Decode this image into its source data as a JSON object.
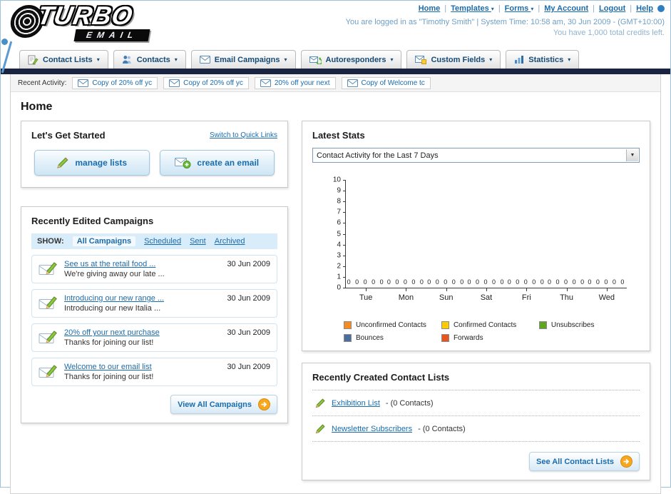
{
  "logo": {
    "line1": "TURBO",
    "line2": "EMAIL"
  },
  "header": {
    "links": [
      {
        "label": "Home",
        "dropdown": false
      },
      {
        "label": "Templates",
        "dropdown": true
      },
      {
        "label": "Forms",
        "dropdown": true
      },
      {
        "label": "My Account",
        "dropdown": false
      },
      {
        "label": "Logout",
        "dropdown": false
      },
      {
        "label": "Help",
        "dropdown": false
      }
    ],
    "login_line": "You are logged in as \"Timothy Smith\" | System Time: 10:58 am, 30 Jun 2009 - (GMT+10:00)",
    "credits_line": "You have 1,000 total credits left."
  },
  "main_nav": [
    {
      "label": "Contact Lists",
      "icon": "contact-lists"
    },
    {
      "label": "Contacts",
      "icon": "contacts"
    },
    {
      "label": "Email Campaigns",
      "icon": "envelope-sm"
    },
    {
      "label": "Autoresponders",
      "icon": "autoresponders"
    },
    {
      "label": "Custom Fields",
      "icon": "custom-fields"
    },
    {
      "label": "Statistics",
      "icon": "statistics"
    }
  ],
  "recent_activity": {
    "label": "Recent Activity:",
    "items": [
      "Copy of 20% off yc",
      "Copy of 20% off yc",
      "20% off your next",
      "Copy of Welcome tc"
    ]
  },
  "page_title": "Home",
  "get_started": {
    "title": "Let's Get Started",
    "switch_link": "Switch to Quick Links",
    "manage_button": "manage lists",
    "create_button": "create an email"
  },
  "campaigns": {
    "title": "Recently Edited Campaigns",
    "show_label": "SHOW:",
    "tabs": [
      "All Campaigns",
      "Scheduled",
      "Sent",
      "Archived"
    ],
    "selected_tab": 0,
    "items": [
      {
        "title": "See us at the retail food ...",
        "subtitle": "We're giving away our late ...",
        "date": "30 Jun 2009"
      },
      {
        "title": "Introducing our new range ...",
        "subtitle": "Introducing our new Italia ...",
        "date": "30 Jun 2009"
      },
      {
        "title": "20% off your next purchase",
        "subtitle": "Thanks for joining our list!",
        "date": "30 Jun 2009"
      },
      {
        "title": "Welcome to our email list",
        "subtitle": "Thanks for joining our list!",
        "date": "30 Jun 2009"
      }
    ],
    "view_all_label": "View All Campaigns"
  },
  "stats": {
    "title": "Latest Stats",
    "dropdown_value": "Contact Activity for the Last 7 Days",
    "chart_data": {
      "type": "bar",
      "title": "Contact Activity for the Last 7 Days",
      "categories": [
        "Tue",
        "Mon",
        "Sun",
        "Sat",
        "Fri",
        "Thu",
        "Wed"
      ],
      "series": [
        {
          "name": "Unconfirmed Contacts",
          "color": "#f68b1f",
          "values": [
            0,
            0,
            0,
            0,
            0,
            0,
            0
          ]
        },
        {
          "name": "Confirmed Contacts",
          "color": "#ffcc00",
          "values": [
            0,
            0,
            0,
            0,
            0,
            0,
            0
          ]
        },
        {
          "name": "Unsubscribes",
          "color": "#61a51f",
          "values": [
            0,
            0,
            0,
            0,
            0,
            0,
            0
          ]
        },
        {
          "name": "Bounces",
          "color": "#4a6e9e",
          "values": [
            0,
            0,
            0,
            0,
            0,
            0,
            0
          ]
        },
        {
          "name": "Forwards",
          "color": "#e8541d",
          "values": [
            0,
            0,
            0,
            0,
            0,
            0,
            0
          ]
        }
      ],
      "ylim": [
        0,
        10
      ],
      "ytick_step": 1,
      "grid": false,
      "legend_position": "bottom",
      "value_labels_shown": true
    }
  },
  "contact_lists": {
    "title": "Recently Created Contact Lists",
    "items": [
      {
        "name": "Exhibition List",
        "count": "- (0 Contacts)"
      },
      {
        "name": "Newsletter Subscribers",
        "count": "- (0 Contacts)"
      }
    ],
    "see_all_label": "See All Contact Lists"
  },
  "colors": {
    "accent_blue": "#1a6cad",
    "navy_bar": "#1a2440",
    "button_orange": "#f7a81d"
  }
}
